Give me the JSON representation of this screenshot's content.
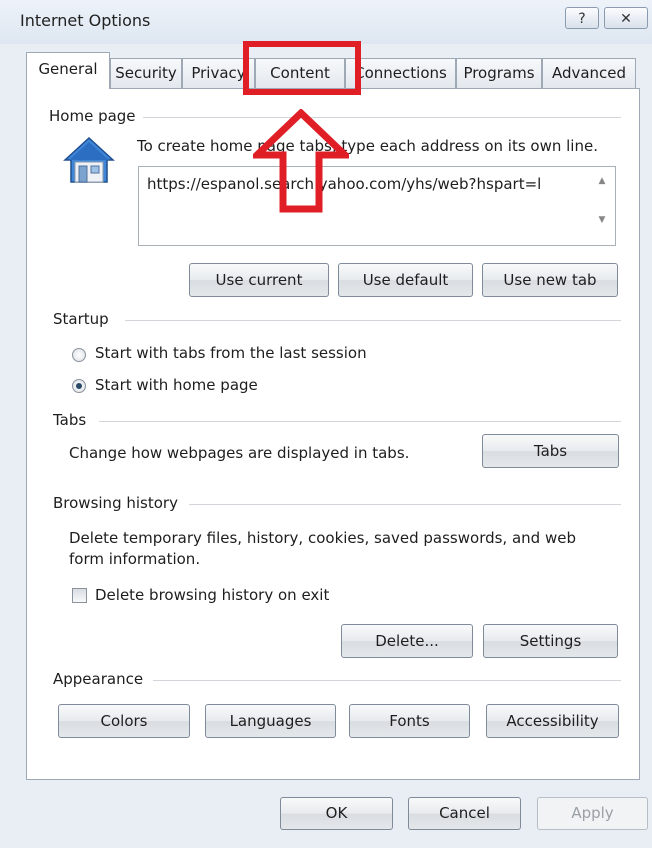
{
  "window": {
    "title": "Internet Options",
    "help_icon": "question-mark-icon",
    "close_icon": "close-icon"
  },
  "tabs": [
    {
      "label": "General",
      "active": true
    },
    {
      "label": "Security"
    },
    {
      "label": "Privacy"
    },
    {
      "label": "Content"
    },
    {
      "label": "Connections"
    },
    {
      "label": "Programs"
    },
    {
      "label": "Advanced"
    }
  ],
  "home_page": {
    "group_label": "Home page",
    "instruction": "To create home page tabs, type each address on its own line.",
    "url": "https://espanol.search.yahoo.com/yhs/web?hspart=l",
    "use_current": "Use current",
    "use_default": "Use default",
    "use_new_tab": "Use new tab"
  },
  "startup": {
    "group_label": "Startup",
    "option_last_session": "Start with tabs from the last session",
    "option_home_page": "Start with home page",
    "selected": "Start with home page"
  },
  "tabs_group": {
    "group_label": "Tabs",
    "description": "Change how webpages are displayed in tabs.",
    "button": "Tabs"
  },
  "browsing_history": {
    "group_label": "Browsing history",
    "description_line1": "Delete temporary files, history, cookies, saved passwords, and web",
    "description_line2": "form information.",
    "checkbox_label": "Delete browsing history on exit",
    "checkbox_checked": false,
    "delete_button": "Delete...",
    "settings_button": "Settings"
  },
  "appearance": {
    "group_label": "Appearance",
    "colors": "Colors",
    "languages": "Languages",
    "fonts": "Fonts",
    "accessibility": "Accessibility"
  },
  "footer": {
    "ok": "OK",
    "cancel": "Cancel",
    "apply": "Apply"
  },
  "highlight_color": "#e01e26"
}
